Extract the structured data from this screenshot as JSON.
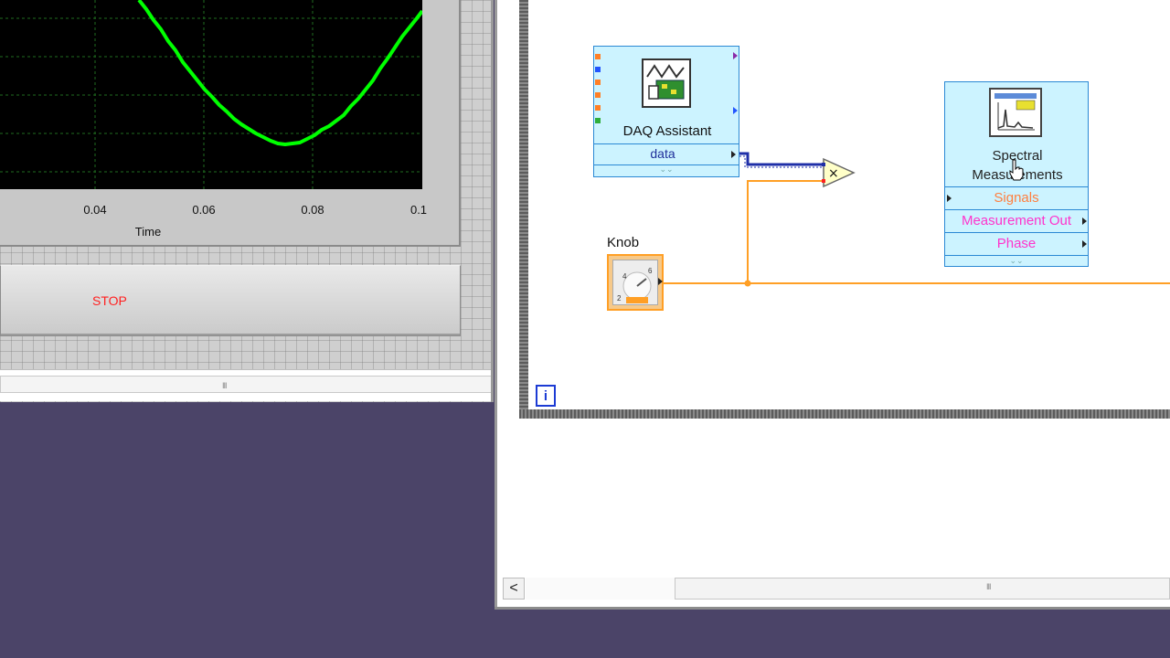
{
  "front_panel": {
    "graph": {
      "x_ticks": [
        "0.04",
        "0.06",
        "0.08",
        "0.1"
      ],
      "x_axis_label": "Time",
      "plot_color": "#00ff00",
      "grid_color": "#1f6b1f"
    },
    "stop_button": {
      "label": "STOP",
      "label_color": "#ff2020"
    },
    "scrollbar_grip": "III"
  },
  "block_diagram": {
    "daq_assistant": {
      "title": "DAQ Assistant",
      "output_label": "data"
    },
    "knob": {
      "label": "Knob"
    },
    "multiply": {
      "symbol": "×"
    },
    "spectral_measurements": {
      "title_line1": "Spectral",
      "title_line2": "Measurements",
      "terminals": [
        "Signals",
        "Measurement Out",
        "Phase"
      ]
    },
    "iteration_terminal": "i",
    "scroll_left_arrow": "<",
    "scrollbar_grip": "III"
  },
  "colors": {
    "desktop": "#4b4468",
    "express_vi_fill": "#ccf3ff",
    "express_vi_border": "#2a88d4",
    "numeric_wire": "#ff9f25",
    "waveform_wire": "#1f2fa8"
  }
}
